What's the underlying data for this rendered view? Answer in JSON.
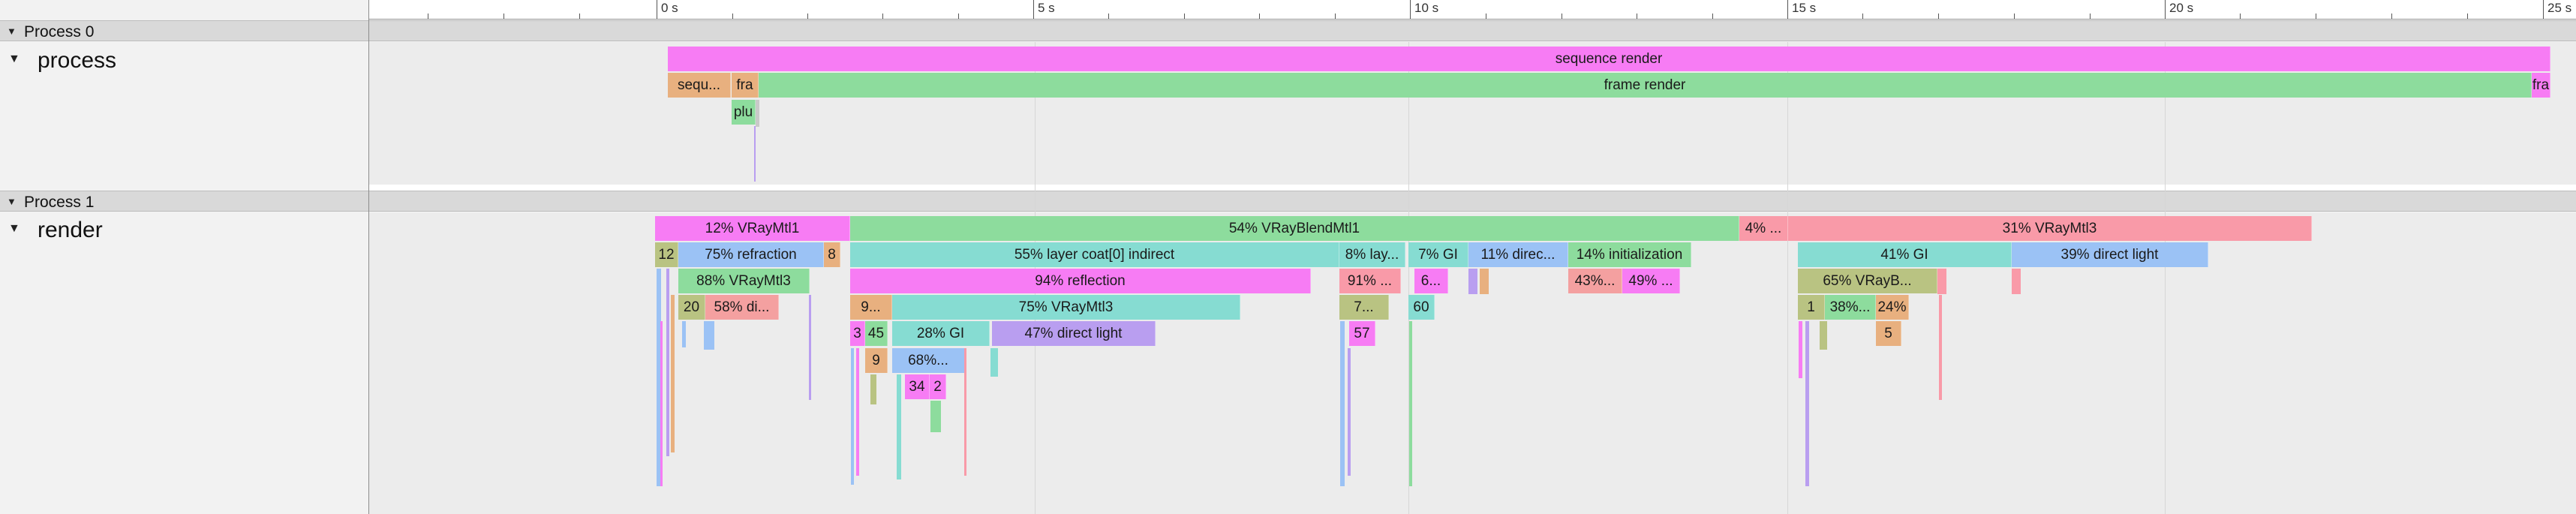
{
  "timeline": {
    "ticks": [
      "0 s",
      "5 s",
      "10 s",
      "15 s",
      "20 s",
      "25 s"
    ]
  },
  "process0": {
    "title": "Process 0",
    "thread": "process",
    "slices": {
      "seq_render": "sequence render",
      "seq_short": "sequ...",
      "fra_1": "fra",
      "frame_render": "frame render",
      "fra_2": "fra",
      "plu": "plu"
    }
  },
  "process1": {
    "title": "Process 1",
    "thread": "render",
    "slices": {
      "vraymtl1_12": "12% VRayMtl1",
      "blend_54": "54% VRayBlendMtl1",
      "four_pct": "4% ...",
      "vraymtl3_31": "31% VRayMtl3",
      "twelve": "12",
      "refraction_75": "75% refraction",
      "eight": "8",
      "layer_coat_55": "55% layer coat[0] indirect",
      "lay_8": "8% lay...",
      "gi_7": "7% GI",
      "direc_11": "11% direc...",
      "init_14": "14% initialization",
      "gi_41": "41% GI",
      "direct_light_39": "39% direct light",
      "vraymtl3_88": "88% VRayMtl3",
      "reflection_94": "94% reflection",
      "ninetyone": "91% ...",
      "six": "6...",
      "fortythree": "43%...",
      "fortynine": "49% ...",
      "vrayb_65": "65% VRayB...",
      "twenty": "20",
      "di_58": "58% di...",
      "nine_dots": "9...",
      "vraymtl3_75": "75% VRayMtl3",
      "seven_dots": "7...",
      "sixty": "60",
      "one": "1",
      "thirtyeight": "38%...",
      "twentyfour": "24%",
      "three": "3",
      "fortyfive": "45",
      "gi_28": "28% GI",
      "direct_light_47": "47% direct light",
      "fiftyseven": "57",
      "five": "5",
      "nine": "9",
      "sixtyeight": "68%...",
      "thirtyfour": "34",
      "two": "2"
    }
  },
  "colors": {
    "magenta": "#f77cf4",
    "green": "#8ddc9d",
    "orange": "#e8b07f",
    "pink": "#f99aa8",
    "teal": "#86dcd2",
    "blue": "#9bc2f5",
    "olive": "#b9c382",
    "lavender": "#b99ef0",
    "salmon": "#f4a0a0"
  }
}
